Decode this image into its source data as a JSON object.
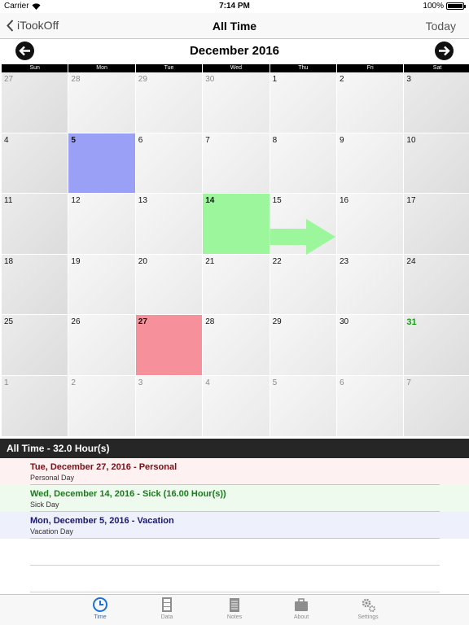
{
  "status": {
    "carrier": "Carrier",
    "time": "7:14 PM",
    "battery": "100%"
  },
  "nav": {
    "back_label": "iTookOff",
    "title": "All Time",
    "today_label": "Today"
  },
  "calendar": {
    "month_title": "December 2016",
    "weekdays": [
      "Sun",
      "Mon",
      "Tue",
      "Wed",
      "Thu",
      "Fri",
      "Sat"
    ],
    "weeks": [
      [
        {
          "d": "27",
          "other": true
        },
        {
          "d": "28",
          "other": true
        },
        {
          "d": "29",
          "other": true
        },
        {
          "d": "30",
          "other": true
        },
        {
          "d": "1"
        },
        {
          "d": "2"
        },
        {
          "d": "3"
        }
      ],
      [
        {
          "d": "4"
        },
        {
          "d": "5",
          "hl": "blue"
        },
        {
          "d": "6"
        },
        {
          "d": "7"
        },
        {
          "d": "8"
        },
        {
          "d": "9"
        },
        {
          "d": "10"
        }
      ],
      [
        {
          "d": "11"
        },
        {
          "d": "12"
        },
        {
          "d": "13"
        },
        {
          "d": "14",
          "hl": "green"
        },
        {
          "d": "15"
        },
        {
          "d": "16"
        },
        {
          "d": "17"
        }
      ],
      [
        {
          "d": "18"
        },
        {
          "d": "19"
        },
        {
          "d": "20"
        },
        {
          "d": "21"
        },
        {
          "d": "22"
        },
        {
          "d": "23"
        },
        {
          "d": "24"
        }
      ],
      [
        {
          "d": "25"
        },
        {
          "d": "26"
        },
        {
          "d": "27",
          "hl": "red"
        },
        {
          "d": "28"
        },
        {
          "d": "29"
        },
        {
          "d": "30"
        },
        {
          "d": "31",
          "today": true
        }
      ],
      [
        {
          "d": "1",
          "other": true
        },
        {
          "d": "2",
          "other": true
        },
        {
          "d": "3",
          "other": true
        },
        {
          "d": "4",
          "other": true
        },
        {
          "d": "5",
          "other": true
        },
        {
          "d": "6",
          "other": true
        },
        {
          "d": "7",
          "other": true
        }
      ]
    ],
    "highlight_colors": {
      "blue": "#9aa0f6",
      "green": "#9cf79c",
      "red": "#f6909a"
    }
  },
  "list": {
    "header": "All Time - 32.0 Hour(s)",
    "entries": [
      {
        "title": "Tue, December 27, 2016 - Personal",
        "subtitle": "Personal Day"
      },
      {
        "title": "Wed, December 14, 2016 - Sick (16.00 Hour(s))",
        "subtitle": "Sick Day"
      },
      {
        "title": "Mon, December 5, 2016 - Vacation",
        "subtitle": "Vacation Day"
      }
    ]
  },
  "tabs": [
    {
      "label": "Time",
      "icon": "clock-icon",
      "active": true
    },
    {
      "label": "Data",
      "icon": "cabinet-icon"
    },
    {
      "label": "Notes",
      "icon": "notepad-icon"
    },
    {
      "label": "About",
      "icon": "briefcase-icon"
    },
    {
      "label": "Settings",
      "icon": "gears-icon"
    }
  ]
}
